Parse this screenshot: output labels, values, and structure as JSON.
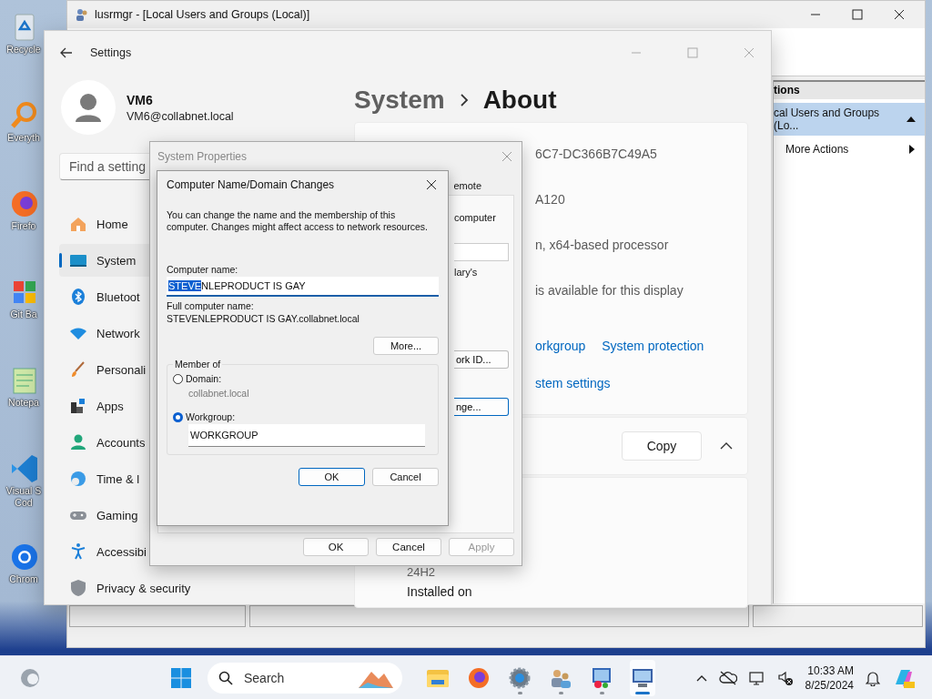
{
  "desktop_icons": [
    {
      "kind": "recycle",
      "lines": [
        "Recycle"
      ]
    },
    {
      "kind": "search",
      "lines": [
        "Everyth"
      ]
    },
    {
      "kind": "browser",
      "lines": [
        "Firefo"
      ]
    },
    {
      "kind": "git",
      "lines": [
        "Git Ba"
      ]
    },
    {
      "kind": "notepad",
      "lines": [
        "Notepa"
      ]
    },
    {
      "kind": "code",
      "lines": [
        "Visual S",
        "Cod"
      ]
    },
    {
      "kind": "chrome",
      "lines": [
        "Chrom"
      ]
    }
  ],
  "lusrmgr": {
    "title": "lusrmgr - [Local Users and Groups (Local)]",
    "actions": {
      "header": "tions",
      "items": [
        {
          "kind": "group",
          "label": "cal Users and Groups (Lo...",
          "selected": true
        },
        {
          "kind": "submenu",
          "label": "More Actions",
          "selected": false
        }
      ]
    }
  },
  "settings": {
    "title": "Settings",
    "user": {
      "name": "VM6",
      "email": "VM6@collabnet.local"
    },
    "search": {
      "placeholder": "Find a setting"
    },
    "nav": [
      {
        "kind": "home",
        "label": "Home",
        "selected": false
      },
      {
        "kind": "system",
        "label": "System",
        "selected": true
      },
      {
        "kind": "bluetooth",
        "label": "Bluetoot",
        "selected": false
      },
      {
        "kind": "network",
        "label": "Network",
        "selected": false
      },
      {
        "kind": "personalization",
        "label": "Personali",
        "selected": false
      },
      {
        "kind": "apps",
        "label": "Apps",
        "selected": false
      },
      {
        "kind": "accounts",
        "label": "Accounts",
        "selected": false
      },
      {
        "kind": "time",
        "label": "Time & l",
        "selected": false
      },
      {
        "kind": "gaming",
        "label": "Gaming",
        "selected": false
      },
      {
        "kind": "accessibility",
        "label": "Accessibi",
        "selected": false
      },
      {
        "kind": "privacy",
        "label": "Privacy & security",
        "selected": false
      }
    ],
    "breadcrumb": {
      "parent": "System",
      "current": "About"
    },
    "specs": [
      "6C7-DC366B7C49A5",
      "A120",
      "n, x64-based processor",
      "is available for this display"
    ],
    "links": [
      [
        "orkgroup",
        "System protection"
      ],
      [
        "stem settings"
      ]
    ],
    "copy_button": "Copy",
    "version": "24H2",
    "installed_label": "Installed on"
  },
  "system_properties": {
    "title": "System Properties",
    "tab": "emote",
    "text_1": "computer",
    "text_2": "lary's",
    "button_1": "ork ID...",
    "button_2": "nge...",
    "buttons": [
      {
        "label": "OK",
        "disabled": false
      },
      {
        "label": "Cancel",
        "disabled": false
      },
      {
        "label": "Apply",
        "disabled": true
      }
    ]
  },
  "name_dialog": {
    "title": "Computer Name/Domain Changes",
    "description": "You can change the name and the membership of this computer. Changes might affect access to network resources.",
    "computer_name_label": "Computer name:",
    "computer_name": {
      "selected_text": "STEVE",
      "rest": "NLEPRODUCT IS GAY"
    },
    "full_name_label": "Full computer name:",
    "full_name": "STEVENLEPRODUCT IS GAY.collabnet.local",
    "more_button": "More...",
    "member_of": {
      "legend": "Member of",
      "options": [
        {
          "label": "Domain:",
          "value": "collabnet.local",
          "selected": false
        },
        {
          "label": "Workgroup:",
          "value": "WORKGROUP",
          "selected": true
        }
      ]
    },
    "buttons": [
      {
        "label": "OK",
        "default": true
      },
      {
        "label": "Cancel",
        "default": false
      }
    ]
  },
  "taskbar": {
    "search_placeholder": "Search",
    "apps": [
      {
        "kind": "folder",
        "running": false,
        "active": false
      },
      {
        "kind": "firefox",
        "running": false,
        "active": false
      },
      {
        "kind": "gear",
        "running": true,
        "active": false
      },
      {
        "kind": "users",
        "running": true,
        "active": false
      },
      {
        "kind": "manager",
        "running": true,
        "active": false
      },
      {
        "kind": "computer",
        "running": true,
        "active": true
      }
    ],
    "time": "10:33 AM",
    "date": "8/25/2024"
  }
}
